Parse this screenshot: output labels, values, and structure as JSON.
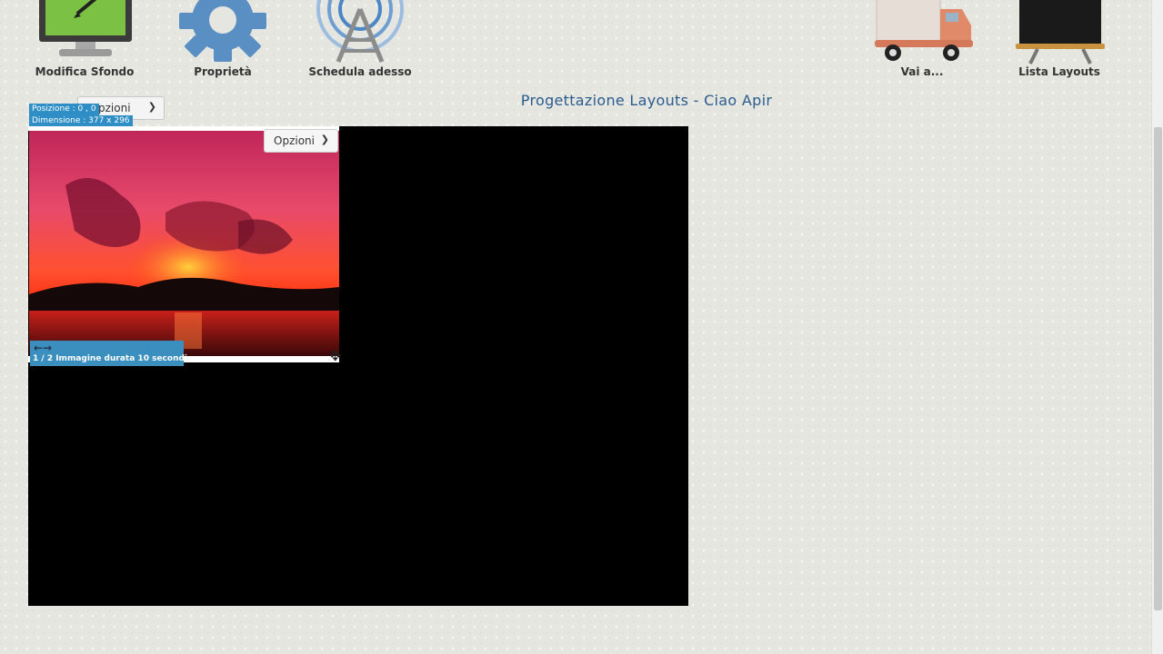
{
  "toolbar": {
    "items": [
      {
        "label": "Modifica Sfondo",
        "icon": "monitor-edit-icon"
      },
      {
        "label": "Proprietà",
        "icon": "gear-icon"
      },
      {
        "label": "Schedula adesso",
        "icon": "antenna-tower-icon"
      },
      {
        "label": "Vai a...",
        "icon": "truck-icon"
      },
      {
        "label": "Lista Layouts",
        "icon": "blackboard-icon"
      }
    ]
  },
  "page": {
    "title": "Progettazione Layouts - Ciao Apir",
    "ghost_options_label": "pzioni"
  },
  "region": {
    "position_label": "Posizione : 0 , 0",
    "dimension_label": "Dimensione : 377 x 296",
    "options_label": "Opzioni",
    "caption": "1 / 2 Immagine durata 10 secondi",
    "nav_arrows": "←→"
  },
  "colors": {
    "title": "#2a5c8e",
    "badge": "#2e8ec5",
    "canvas": "#000000"
  }
}
